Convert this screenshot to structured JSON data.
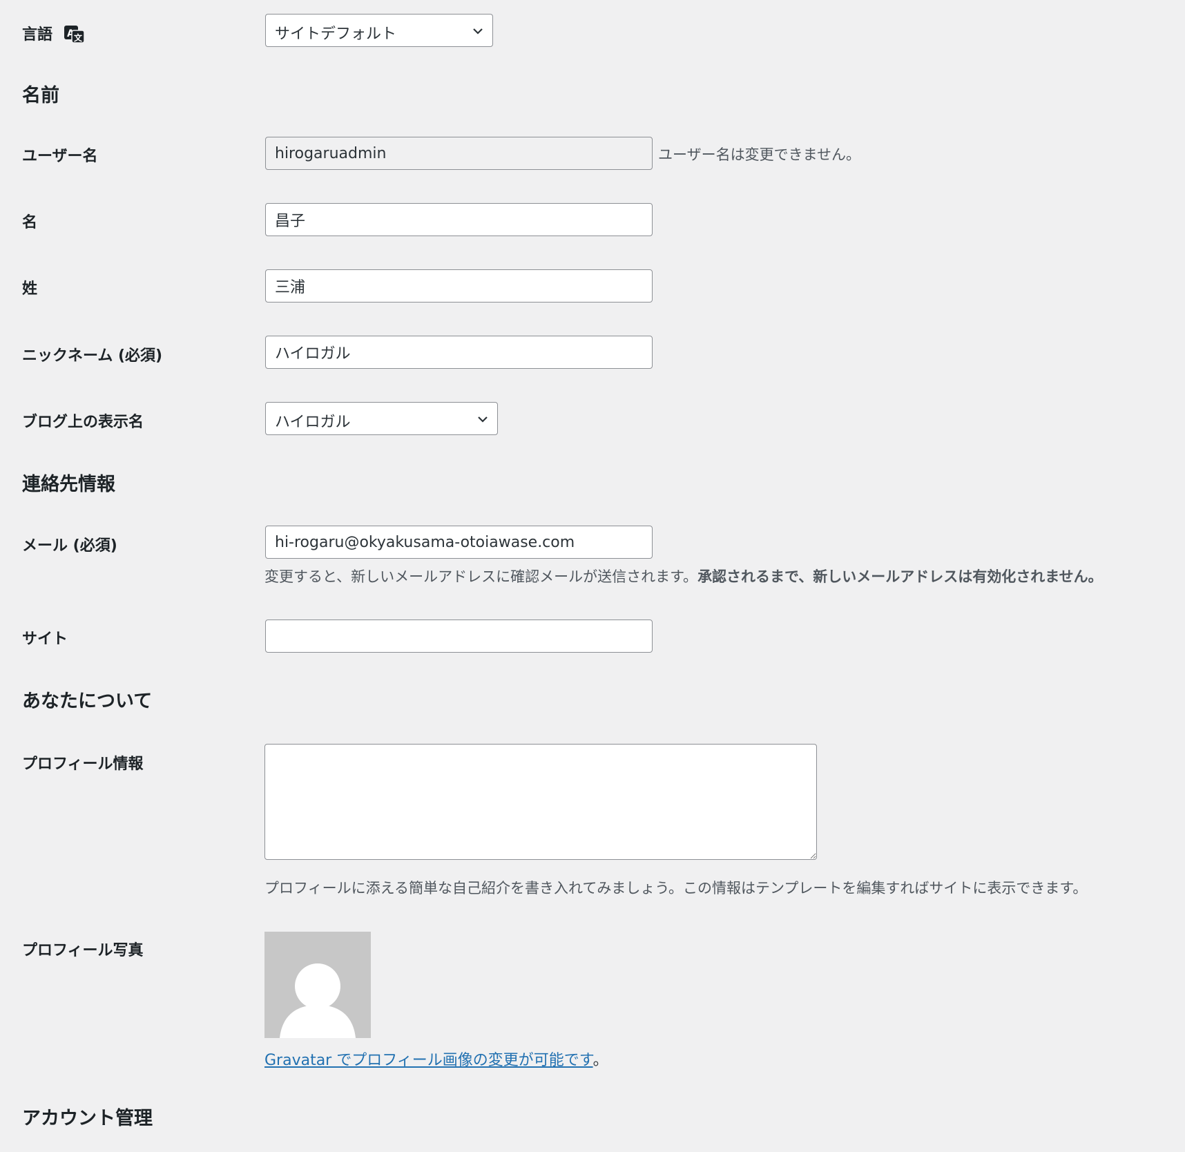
{
  "language": {
    "label": "言語",
    "icon": "translation-icon",
    "selected": "サイトデフォルト"
  },
  "sections": {
    "name": "名前",
    "contact": "連絡先情報",
    "about": "あなたについて",
    "account": "アカウント管理"
  },
  "username": {
    "label": "ユーザー名",
    "value": "hirogaruadmin",
    "note": "ユーザー名は変更できません。"
  },
  "first_name": {
    "label": "名",
    "value": "昌子"
  },
  "last_name": {
    "label": "姓",
    "value": "三浦"
  },
  "nickname": {
    "label": "ニックネーム (必須)",
    "value": "ハイロガル"
  },
  "display_name": {
    "label": "ブログ上の表示名",
    "selected": "ハイロガル"
  },
  "email": {
    "label": "メール (必須)",
    "value": "hi-rogaru@okyakusama-otoiawase.com",
    "note_plain": "変更すると、新しいメールアドレスに確認メールが送信されます。",
    "note_bold": "承認されるまで、新しいメールアドレスは有効化されません。"
  },
  "website": {
    "label": "サイト",
    "value": ""
  },
  "bio": {
    "label": "プロフィール情報",
    "value": "",
    "note": "プロフィールに添える簡単な自己紹介を書き入れてみましょう。この情報はテンプレートを編集すればサイトに表示できます。"
  },
  "profile_picture": {
    "label": "プロフィール写真",
    "link_text": "Gravatar でプロフィール画像の変更が可能です",
    "suffix": "。"
  },
  "colors": {
    "background": "#f0f0f1",
    "link": "#2271b1",
    "avatar_bg": "#c7c7c7"
  }
}
